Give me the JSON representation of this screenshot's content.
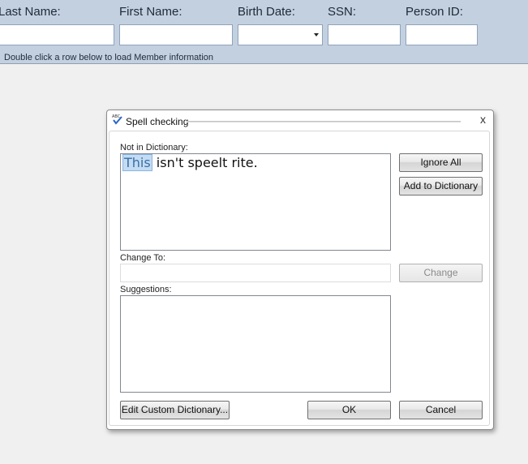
{
  "search_form": {
    "last_name_label": "Last Name:",
    "first_name_label": "First Name:",
    "birth_date_label": "Birth Date:",
    "ssn_label": "SSN:",
    "person_id_label": "Person ID:",
    "hint": "Double click a row below to load Member information"
  },
  "dialog": {
    "title": "Spell checking",
    "close_label": "x",
    "not_in_dictionary_label": "Not in Dictionary:",
    "highlighted_word": "This",
    "sentence_rest": " isn't speelt rite.",
    "change_to_label": "Change To:",
    "change_to_value": "",
    "suggestions_label": "Suggestions:",
    "buttons": {
      "ignore_all": "Ignore All",
      "add_to_dictionary": "Add to Dictionary",
      "change": "Change",
      "edit_custom_dictionary": "Edit Custom Dictionary...",
      "ok": "OK",
      "cancel": "Cancel"
    }
  }
}
